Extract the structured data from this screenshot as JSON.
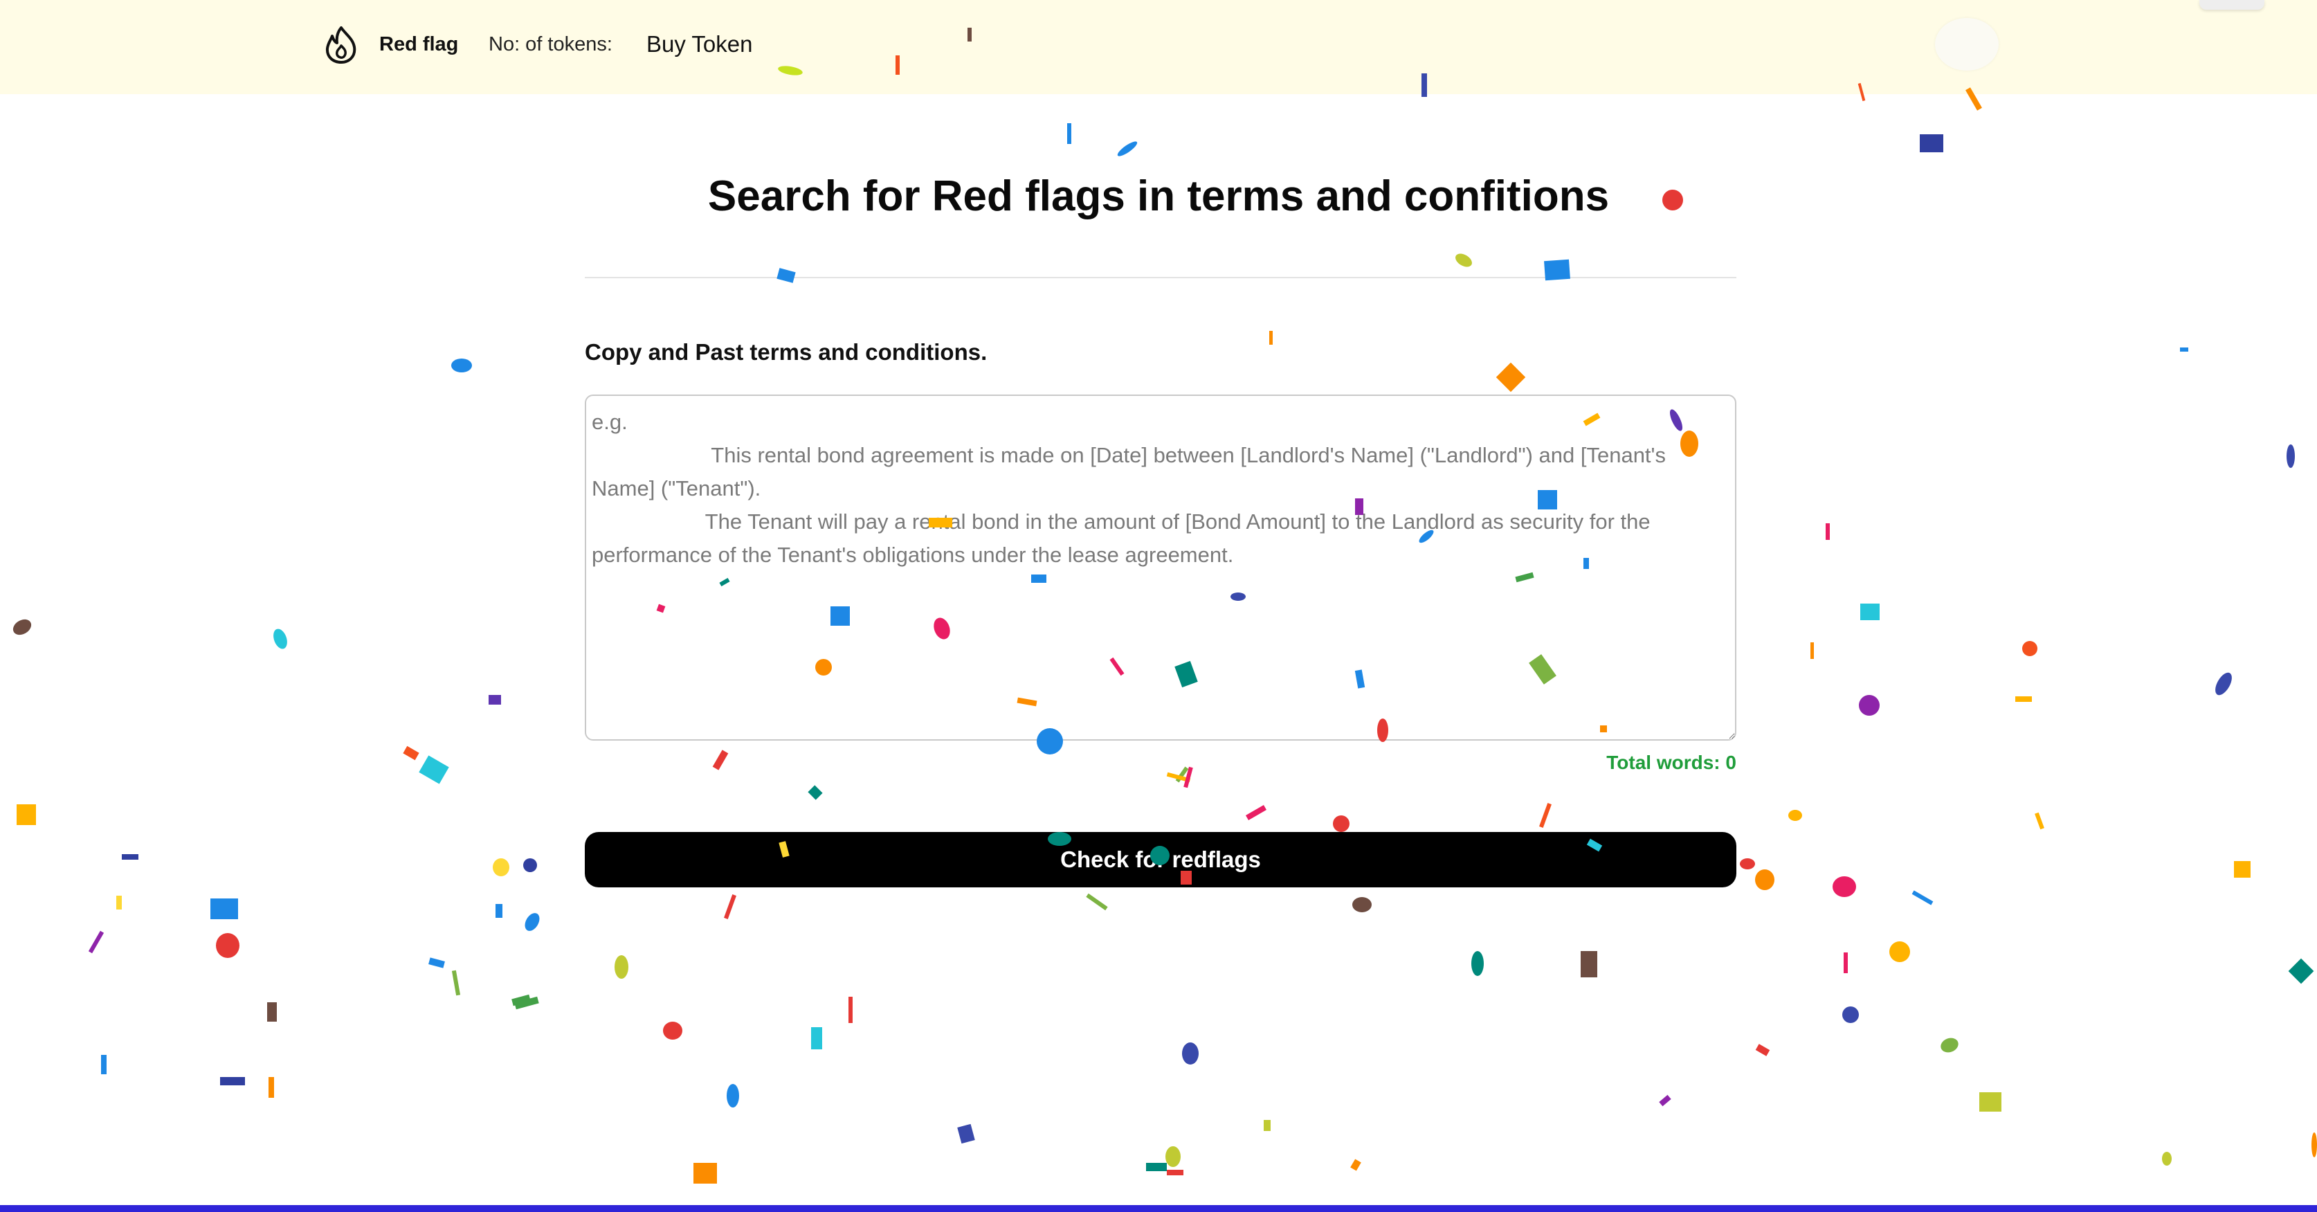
{
  "navbar": {
    "brand_name": "Red flag",
    "tokens_label": "No: of tokens:",
    "buy_token_label": "Buy Token",
    "background_color": "#fffce6",
    "brand_icon": "flame-icon"
  },
  "main": {
    "title": "Search for Red flags in terms and confitions",
    "field_label": "Copy and Past terms and conditions.",
    "textarea": {
      "value": "",
      "placeholder": "e.g.\n                    This rental bond agreement is made on [Date] between [Landlord's Name] (\"Landlord\") and [Tenant's Name] (\"Tenant\").\n                   The Tenant will pay a rental bond in the amount of [Bond Amount] to the Landlord as security for the performance of the Tenant's obligations under the lease agreement."
    },
    "word_count_label": "Total words:",
    "word_count_value": "0",
    "submit_label": "Check for redflags"
  },
  "colors": {
    "accent_button": "#000000",
    "word_count": "#1f9d3a",
    "bottom_bar": "#2f24d8"
  },
  "decorations": {
    "confetti_icon": "confetti-particles"
  }
}
